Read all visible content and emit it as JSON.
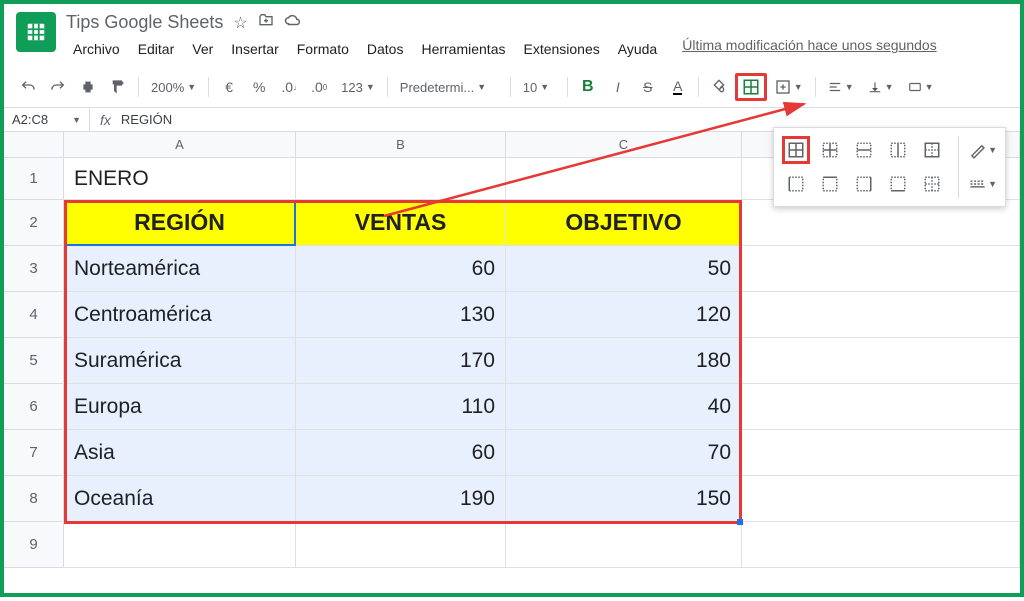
{
  "doc_title": "Tips Google Sheets",
  "menus": [
    "Archivo",
    "Editar",
    "Ver",
    "Insertar",
    "Formato",
    "Datos",
    "Herramientas",
    "Extensiones",
    "Ayuda"
  ],
  "last_modified": "Última modificación hace unos segundos",
  "toolbar": {
    "zoom": "200%",
    "font": "Predetermi...",
    "font_size": "10",
    "currency": "€",
    "percent": "%",
    "dec_dec": ".0",
    "inc_dec": ".00",
    "num_fmt": "123"
  },
  "name_box": "A2:C8",
  "formula_value": "REGIÓN",
  "columns": [
    "A",
    "B",
    "C"
  ],
  "rows": [
    "1",
    "2",
    "3",
    "4",
    "5",
    "6",
    "7",
    "8",
    "9"
  ],
  "cell_a1": "ENERO",
  "headers": {
    "a": "REGIÓN",
    "b": "VENTAS",
    "c": "OBJETIVO"
  },
  "data": [
    {
      "region": "Norteamérica",
      "ventas": "60",
      "objetivo": "50"
    },
    {
      "region": "Centroamérica",
      "ventas": "130",
      "objetivo": "120"
    },
    {
      "region": "Suramérica",
      "ventas": "170",
      "objetivo": "180"
    },
    {
      "region": "Europa",
      "ventas": "110",
      "objetivo": "40"
    },
    {
      "region": "Asia",
      "ventas": "60",
      "objetivo": "70"
    },
    {
      "region": "Oceanía",
      "ventas": "190",
      "objetivo": "150"
    }
  ],
  "chart_data": {
    "type": "table",
    "title": "ENERO",
    "columns": [
      "REGIÓN",
      "VENTAS",
      "OBJETIVO"
    ],
    "rows": [
      [
        "Norteamérica",
        60,
        50
      ],
      [
        "Centroamérica",
        130,
        120
      ],
      [
        "Suramérica",
        170,
        180
      ],
      [
        "Europa",
        110,
        40
      ],
      [
        "Asia",
        60,
        70
      ],
      [
        "Oceanía",
        190,
        150
      ]
    ]
  }
}
